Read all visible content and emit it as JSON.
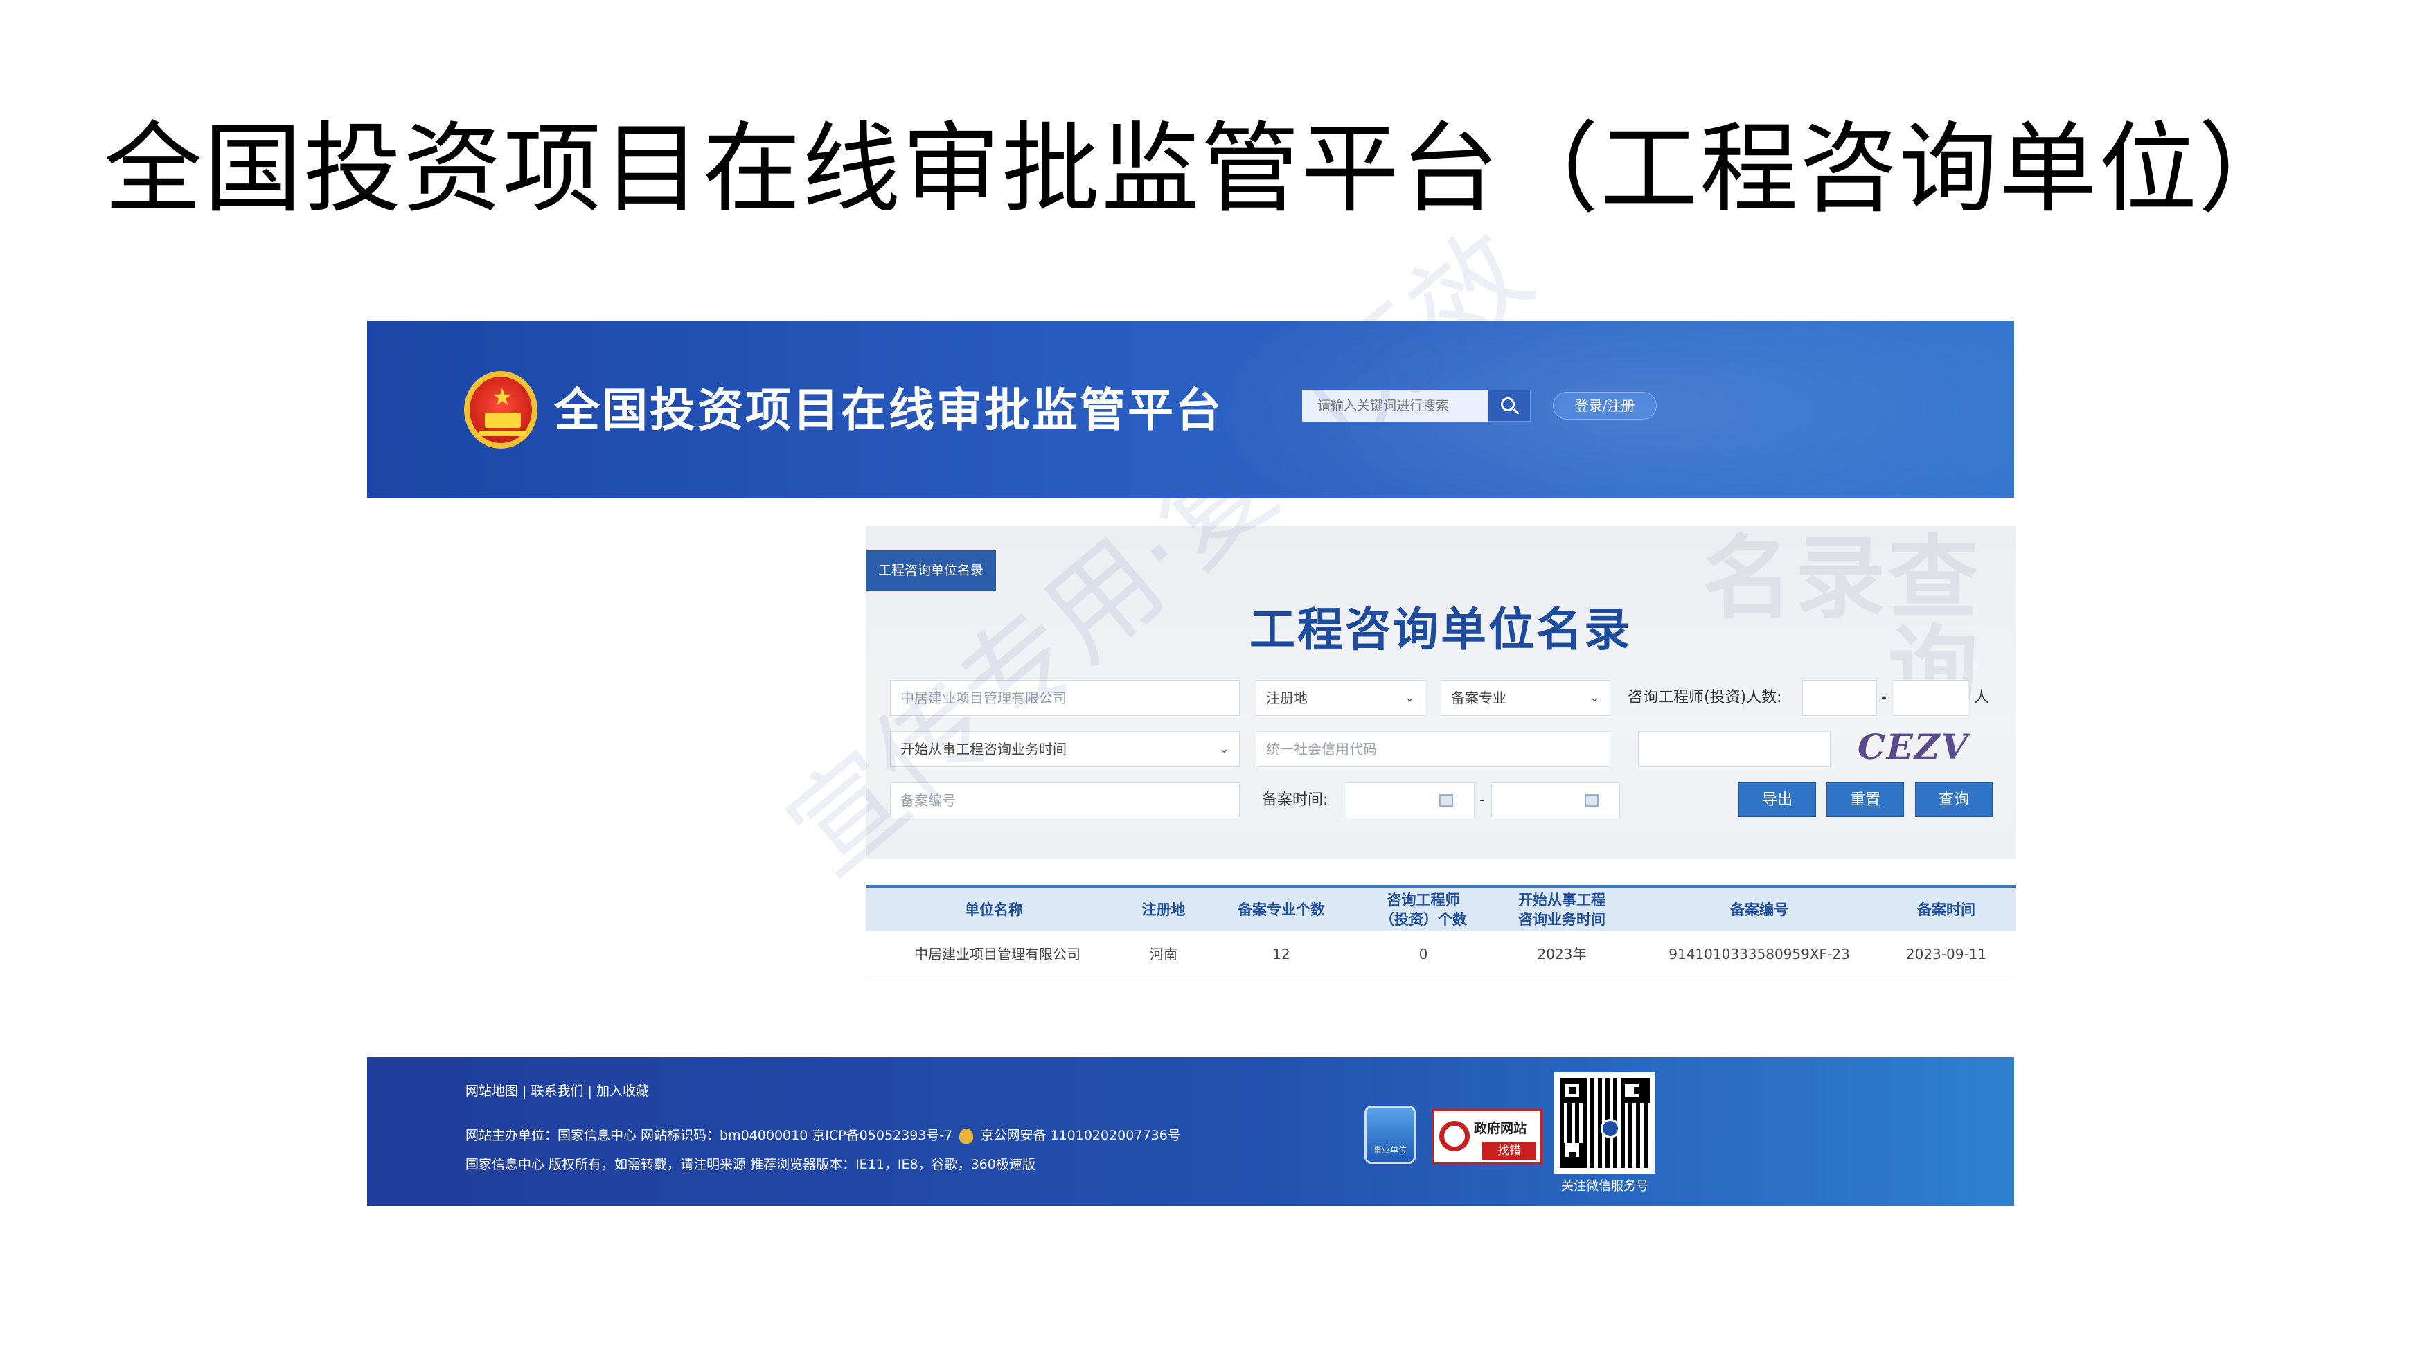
{
  "slide": {
    "title": "全国投资项目在线审批监管平台（工程咨询单位）",
    "watermark": "宣传专用·复印无效"
  },
  "header": {
    "site_title": "全国投资项目在线审批监管平台",
    "search_placeholder": "请输入关键词进行搜索",
    "login_label": "登录/注册"
  },
  "panel": {
    "tag": "工程咨询单位名录",
    "title": "工程咨询单位名录",
    "deco_text": "名录查询",
    "fields": {
      "company_value": "中居建业项目管理有限公司",
      "region_select": "注册地",
      "specialty_select": "备案专业",
      "engineers_label": "咨询工程师(投资)人数:",
      "range_sep": "-",
      "unit_person": "人",
      "start_time_select": "开始从事工程咨询业务时间",
      "credit_code_placeholder": "统一社会信用代码",
      "captcha_text": "CEZV",
      "record_no_placeholder": "备案编号",
      "record_time_label": "备案时间:"
    },
    "buttons": {
      "export": "导出",
      "reset": "重置",
      "query": "查询"
    }
  },
  "table": {
    "headers": [
      "单位名称",
      "注册地",
      "备案专业个数",
      "咨询工程师\n（投资）个数",
      "开始从事工程\n咨询业务时间",
      "备案编号",
      "备案时间"
    ],
    "rows": [
      [
        "中居建业项目管理有限公司",
        "河南",
        "12",
        "0",
        "2023年",
        "9141010333580959XF-23",
        "2023-09-11"
      ]
    ]
  },
  "footer": {
    "links": "网站地图 | 联系我们 | 加入收藏",
    "line2_a": "网站主办单位：国家信息中心   网站标识码：bm04000010   京ICP备05052393号-7",
    "line2_b": "京公网安备 11010202007736号",
    "line3": "国家信息中心 版权所有，如需转载，请注明来源   推荐浏览器版本：IE11，IE8，谷歌，360极速版",
    "badge_unit": "事业单位",
    "gov_badge_t1": "政府网站",
    "gov_badge_t2": "找错",
    "qr_caption": "关注微信服务号"
  },
  "colors": {
    "header_blue": "#2a5cc0",
    "panel_title_blue": "#1d4c9e",
    "button_blue": "#2f74c5",
    "footer_blue": "#2351b0"
  }
}
